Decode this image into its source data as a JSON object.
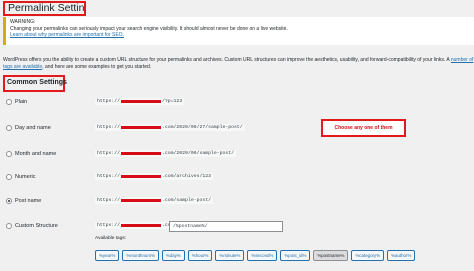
{
  "page_title": "Permalink Settings",
  "notice": {
    "heading": "WARNING:",
    "line": "Changing your permalinks can seriously impact your search engine visibility. It should almost never be done on a live website.",
    "link": "Learn about why permalinks are important for SEO."
  },
  "intro": {
    "text1": "WordPress offers you the ability to create a custom URL structure for your permalinks and archives. Custom URL structures can improve the aesthetics, usability, and forward-compatibility of your links. A",
    "link": "number of tags are available",
    "text2": ", and here are some examples to get you started."
  },
  "section_title": "Common Settings",
  "options": [
    {
      "label": "Plain",
      "prefix": "https://",
      "suffix": "/?p=123",
      "selected": false
    },
    {
      "label": "Day and name",
      "prefix": "https://",
      "suffix": ".com/2020/06/27/sample-post/",
      "selected": false
    },
    {
      "label": "Month and name",
      "prefix": "https://",
      "suffix": ".com/2020/06/sample-post/",
      "selected": false
    },
    {
      "label": "Numeric",
      "prefix": "https://",
      "suffix": ".com/archives/123",
      "selected": false
    },
    {
      "label": "Post name",
      "prefix": "https://",
      "suffix": ".com/sample-post/",
      "selected": true
    },
    {
      "label": "Custom Structure",
      "prefix": "https://",
      "suffix": ".com",
      "selected": false
    }
  ],
  "custom_value": "/%postname%/",
  "callout": "Choose any one of them",
  "available_tags_label": "Available tags:",
  "tags": [
    "%year%",
    "%monthnum%",
    "%day%",
    "%hour%",
    "%minute%",
    "%second%",
    "%post_id%",
    "%postname%",
    "%category%",
    "%author%"
  ],
  "active_tag_index": 7
}
